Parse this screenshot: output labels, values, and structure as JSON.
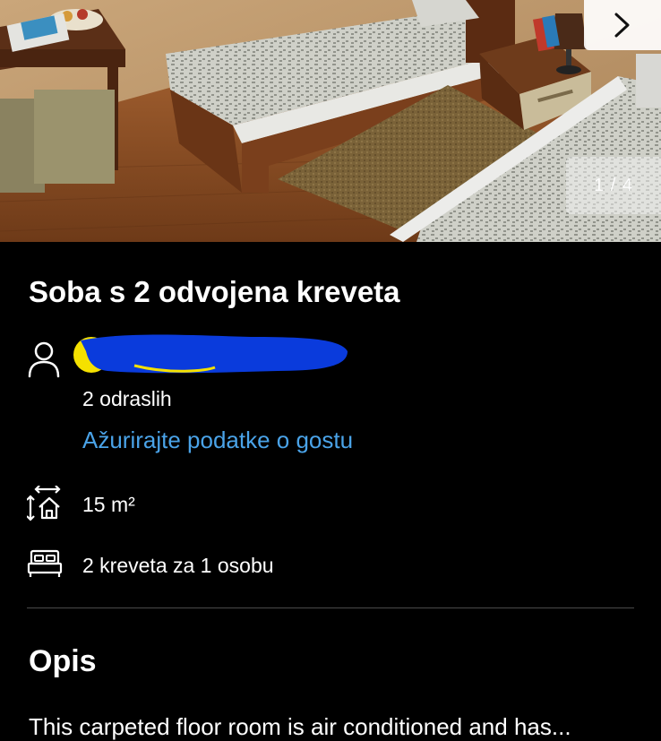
{
  "gallery": {
    "counter": "1 / 4",
    "next_icon": "chevron-right-icon"
  },
  "room": {
    "title": "Soba s 2 odvojena kreveta",
    "guest_icon": "person-icon",
    "guests": "2 odraslih",
    "update_link": "Ažurirajte podatke o gostu",
    "size_icon": "room-size-icon",
    "size": "15 m²",
    "beds_icon": "bed-icon",
    "beds": "2 kreveta za 1 osobu"
  },
  "description": {
    "heading": "Opis",
    "text_cut": "This carpeted floor room is air conditioned and has..."
  },
  "colors": {
    "background": "#000000",
    "link": "#4aa3e8",
    "redaction_blue": "#0a3bdc",
    "redaction_yellow": "#f5e100"
  }
}
